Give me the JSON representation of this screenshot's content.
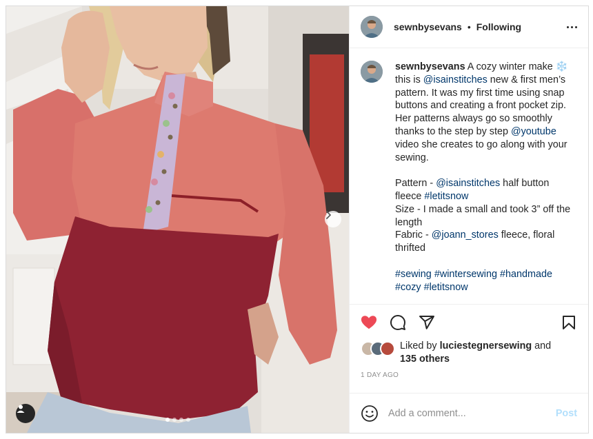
{
  "post": {
    "username": "sewnbysevans",
    "separator": "•",
    "follow_status": "Following",
    "caption": {
      "username": "sewnbysevans",
      "intro_text": " A cozy winter make ",
      "snow_emoji": "❄️",
      "text_1": " this is ",
      "mention_1": "@isainstitches",
      "text_2": " new & first men’s pattern. It was my first time using snap buttons and creating a front pocket zip. Her patterns always go so smoothly thanks to the step by step ",
      "mention_2": "@youtube",
      "text_3": " video she creates to go along with your sewing.",
      "pattern_label": "Pattern - ",
      "pattern_mention": "@isainstitches",
      "pattern_text": " half button fleece ",
      "pattern_hashtag": "#letitsnow",
      "size_text": "Size - I made a small and took 3” off the length",
      "fabric_label": "Fabric - ",
      "fabric_mention": "@joann_stores",
      "fabric_text": " fleece, floral thrifted",
      "hashtags": [
        "#sewing",
        "#wintersewing",
        "#handmade",
        "#cozy",
        "#letitsnow"
      ],
      "trailing": "."
    },
    "actions": {
      "like_icon": "heart-filled-icon",
      "comment_icon": "comment-bubble-icon",
      "share_icon": "paper-plane-icon",
      "save_icon": "bookmark-icon",
      "like_color": "#ed4956"
    },
    "likes": {
      "prefix": "Liked by ",
      "user": "luciestegnersewing",
      "connector": " and",
      "others": "135 others"
    },
    "timestamp": "1 DAY AGO",
    "comment": {
      "placeholder": "Add a comment...",
      "post_label": "Post"
    },
    "carousel": {
      "slide_count": 4,
      "active_index": 0
    },
    "colors": {
      "link": "#00376b",
      "post_button_disabled": "#b2dffc",
      "muted": "#8e8e8e",
      "text": "#262626"
    }
  }
}
